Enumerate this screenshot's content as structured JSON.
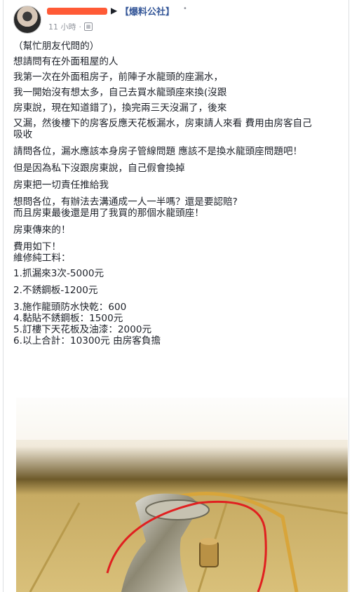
{
  "post": {
    "group_name": "【爆料公社】",
    "time": "11 小時",
    "more": "•"
  },
  "lines": [
    "（幫忙朋友代問的）",
    "想請問有在外面租屋的人",
    "我第一次在外面租房子，前陣子水龍頭的座漏水，",
    "我一開始沒有想太多，自己去買水龍頭座來換(沒跟",
    "房東說，現在知道錯了)，換完兩三天沒漏了，後來",
    "又漏，然後樓下的房客反應天花板漏水，房東請人來看 費用由房客自己",
    "吸收",
    "請問各位，漏水應該本身房子管線問題 應該不是換水龍頭座問題吧！",
    "但是因為私下沒跟房東說，自己假會換掉",
    "房東把一切責任推給我",
    "想問各位，有辦法去溝通成一人一半嗎？還是要認賠?",
    "而且房東最後還是用了我買的那個水龍頭座！",
    "房東傳來的！",
    "費用如下！",
    "維修純工料：",
    "1.抓漏來3次-5000元",
    "2.不銹鋼板-1200元",
    "3.施作龍頭防水快乾：600",
    "4.黏貼不銹鋼板：1500元",
    "5.訂樓下天花板及油漆：2000元",
    "6.以上合計：10300元 由房客負擔"
  ]
}
